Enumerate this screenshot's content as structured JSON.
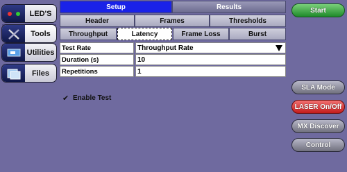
{
  "sidebar": {
    "items": [
      {
        "label": "LED'S",
        "icon": "leds-icon"
      },
      {
        "label": "Tools",
        "icon": "tools-icon"
      },
      {
        "label": "Utilities",
        "icon": "utilities-icon"
      },
      {
        "label": "Files",
        "icon": "files-icon"
      }
    ]
  },
  "main_tabs": [
    "Setup",
    "Results"
  ],
  "sub_tabs_row1": [
    "Header",
    "Frames",
    "Thresholds"
  ],
  "sub_tabs_row2": [
    "Throughput",
    "Latency",
    "Frame Loss",
    "Burst"
  ],
  "form": {
    "test_rate": {
      "label": "Test Rate",
      "value": "Throughput Rate"
    },
    "duration": {
      "label": "Duration (s)",
      "value": "10"
    },
    "repetitions": {
      "label": "Repetitions",
      "value": "1"
    },
    "enable_test": {
      "label": "Enable Test",
      "checked": true,
      "mark": "✔"
    }
  },
  "right_panel": {
    "start": "Start",
    "sla_mode": "SLA Mode",
    "laser": "LASER On/Off",
    "mx_discover": "MX Discover",
    "control": "Control"
  },
  "colors": {
    "background": "#6f6a9f",
    "active_tab": "#1a22e8",
    "start_button": "#2a9a34",
    "laser_button": "#d62828"
  }
}
